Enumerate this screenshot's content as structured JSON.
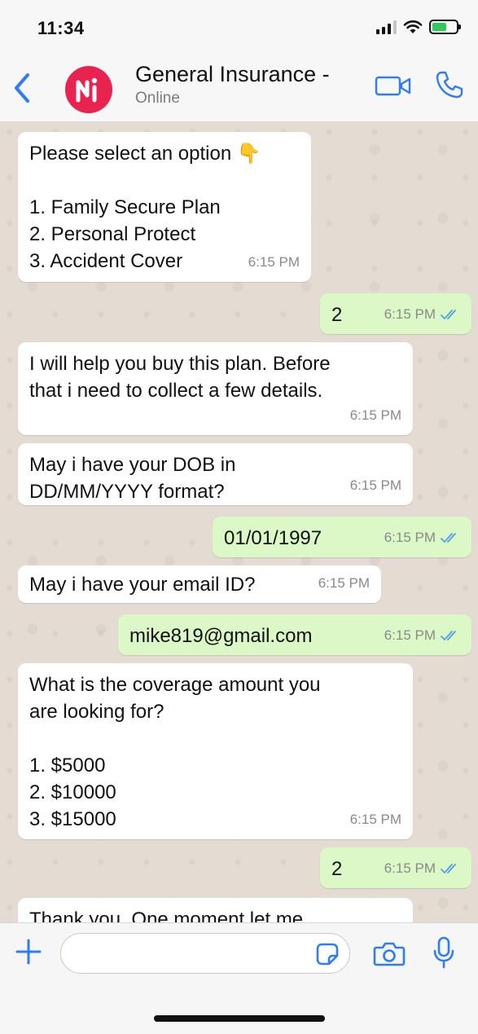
{
  "status_bar": {
    "time": "11:34"
  },
  "header": {
    "contact_name": "General Insurance -",
    "contact_status": "Online",
    "avatar_letter": "N",
    "colors": {
      "accent": "#2f7cf6",
      "avatar": "#e8234f"
    }
  },
  "messages": [
    {
      "from": "bot",
      "text": "Please select an option 👇\n\n1. Family Secure Plan\n2. Personal Protect\n3. Accident Cover",
      "time": "6:15 PM"
    },
    {
      "from": "user",
      "text": "2",
      "time": "6:15 PM"
    },
    {
      "from": "bot",
      "text": "I will help you buy this plan. Before\nthat i need to collect a few details.",
      "time": "6:15 PM"
    },
    {
      "from": "bot",
      "text": "May i have your DOB in\nDD/MM/YYYY format?",
      "time": "6:15 PM"
    },
    {
      "from": "user",
      "text": "01/01/1997",
      "time": "6:15 PM"
    },
    {
      "from": "bot",
      "text": "May i have your email ID?",
      "time": "6:15 PM"
    },
    {
      "from": "user",
      "text": "mike819@gmail.com",
      "time": "6:15 PM"
    },
    {
      "from": "bot",
      "text": "What is the coverage amount you\nare looking for?\n\n1. $5000\n2. $10000\n3. $15000",
      "time": "6:15 PM"
    },
    {
      "from": "user",
      "text": "2",
      "time": "6:15 PM"
    },
    {
      "from": "bot",
      "text": "Thank you. One moment let me",
      "time": ""
    }
  ],
  "composer": {
    "placeholder": ""
  },
  "icons": {
    "back": "chevron-left-icon",
    "video": "video-camera-icon",
    "call": "phone-icon",
    "plus": "plus-icon",
    "sticker": "sticker-icon",
    "camera": "camera-icon",
    "mic": "microphone-icon",
    "read": "double-check-icon"
  }
}
